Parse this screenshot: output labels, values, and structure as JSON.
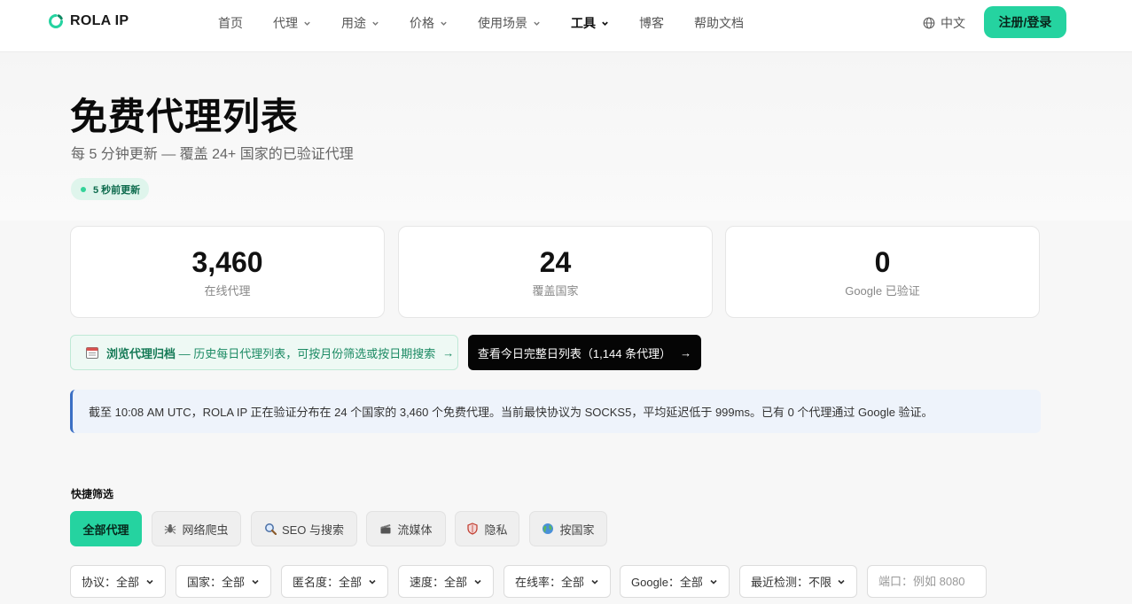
{
  "brand": {
    "name": "ROLA IP",
    "accent": "#25d3a0"
  },
  "nav": {
    "items": [
      {
        "label": "首页",
        "has_dropdown": false
      },
      {
        "label": "代理",
        "has_dropdown": true
      },
      {
        "label": "用途",
        "has_dropdown": true
      },
      {
        "label": "价格",
        "has_dropdown": true
      },
      {
        "label": "使用场景",
        "has_dropdown": true
      },
      {
        "label": "工具",
        "has_dropdown": true,
        "active": true
      },
      {
        "label": "博客",
        "has_dropdown": false
      },
      {
        "label": "帮助文档",
        "has_dropdown": false
      }
    ],
    "language": "中文",
    "signup_label": "注册/登录"
  },
  "hero": {
    "title": "免费代理列表",
    "subtitle": "每 5 分钟更新 — 覆盖 24+ 国家的已验证代理",
    "fresh_badge": "5 秒前更新"
  },
  "stats": [
    {
      "value": "3,460",
      "label": "在线代理"
    },
    {
      "value": "24",
      "label": "覆盖国家"
    },
    {
      "value": "0",
      "label": "Google 已验证"
    }
  ],
  "archive": {
    "icon": "calendar-icon",
    "bold": "浏览代理归档",
    "text": " — 历史每日代理列表，可按月份筛选或按日期搜索",
    "arrow": "→"
  },
  "daily_button": {
    "label": "查看今日完整日列表（1,144 条代理）",
    "arrow": "→"
  },
  "info_text": "截至 10:08 AM UTC，ROLA IP 正在验证分布在 24 个国家的 3,460 个免费代理。当前最快协议为 SOCKS5，平均延迟低于 999ms。已有 0 个代理通过 Google 验证。",
  "quick_filter": {
    "label": "快捷筛选",
    "chips": [
      {
        "label": "全部代理",
        "icon": "",
        "active": true
      },
      {
        "label": "网络爬虫",
        "icon": "spider-icon"
      },
      {
        "label": "SEO 与搜索",
        "icon": "magnifier-icon"
      },
      {
        "label": "流媒体",
        "icon": "clapper-icon"
      },
      {
        "label": "隐私",
        "icon": "shield-icon"
      },
      {
        "label": "按国家",
        "icon": "globe-icon"
      }
    ]
  },
  "filters": [
    {
      "label": "协议：全部"
    },
    {
      "label": "国家：全部"
    },
    {
      "label": "匿名度：全部"
    },
    {
      "label": "速度：全部"
    },
    {
      "label": "在线率：全部"
    },
    {
      "label": "Google：全部"
    },
    {
      "label": "最近检测：不限"
    }
  ],
  "port_input": {
    "placeholder": "端口：例如 8080",
    "value": ""
  }
}
